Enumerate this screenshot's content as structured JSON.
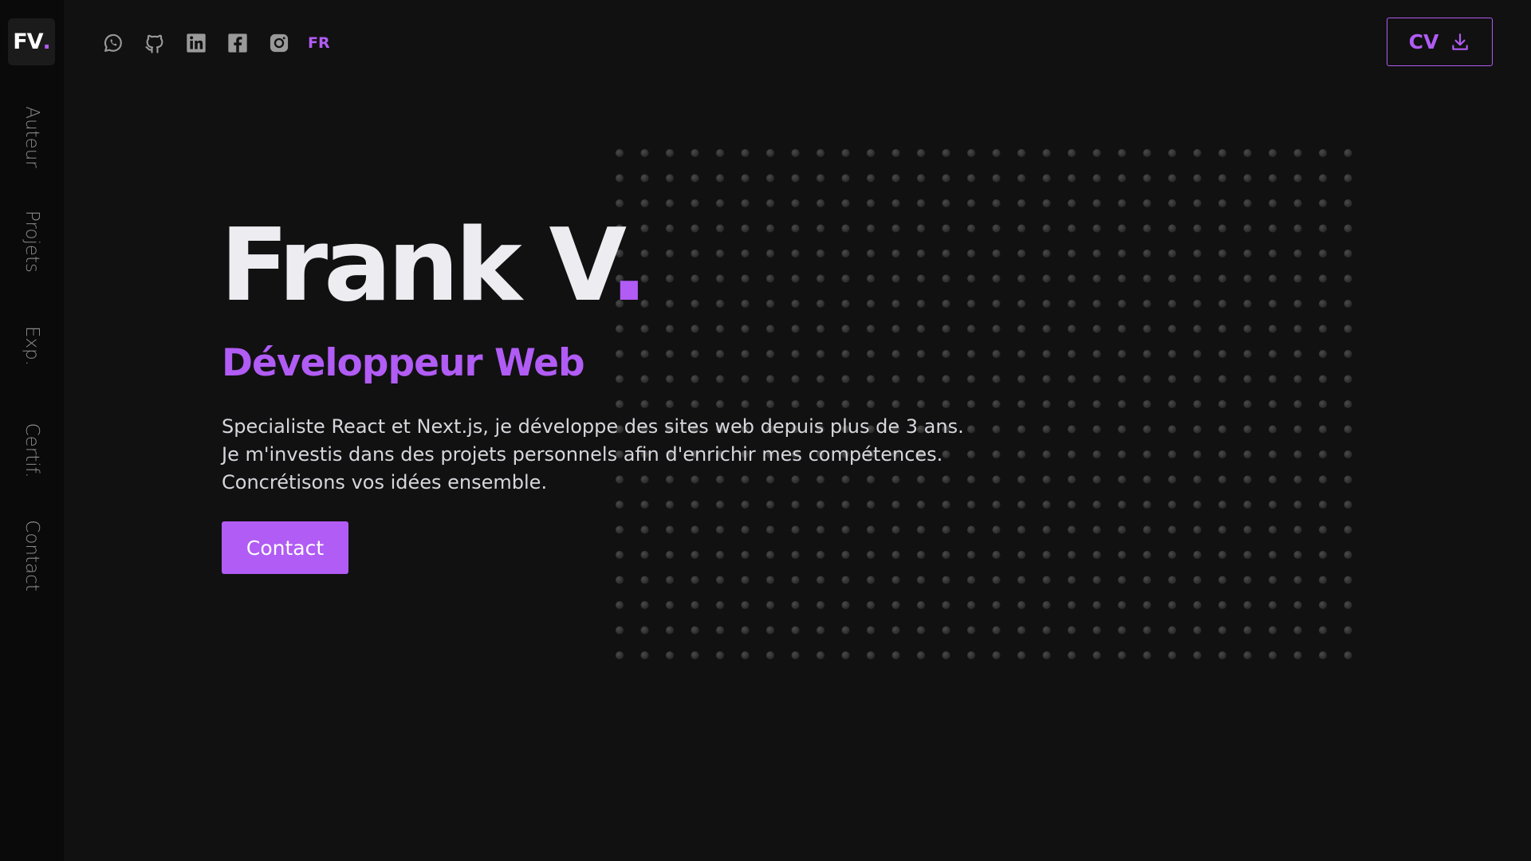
{
  "brand": {
    "logo_text": "FV",
    "logo_dot": "."
  },
  "colors": {
    "accent": "#b15cf5",
    "background": "#111111",
    "sidebar": "#0a0a0a",
    "text": "#ececf1"
  },
  "sidebar": {
    "items": [
      {
        "label": "Auteur"
      },
      {
        "label": "Projets"
      },
      {
        "label": "Exp."
      },
      {
        "label": "Certif."
      },
      {
        "label": "Contact"
      }
    ]
  },
  "header": {
    "social_icons": [
      "whatsapp-icon",
      "github-icon",
      "linkedin-icon",
      "facebook-icon",
      "instagram-icon"
    ],
    "language": "FR",
    "cv_label": "CV",
    "cv_icon": "download-icon"
  },
  "hero": {
    "name": "Frank V",
    "name_dot": ".",
    "role": "Développeur Web",
    "description": [
      "Specialiste React et Next.js, je développe des sites web depuis plus de 3 ans.",
      "Je m'investis dans des projets personnels afin d'enrichir mes compétences.",
      "Concrétisons vos idées ensemble."
    ],
    "contact_label": "Contact"
  }
}
